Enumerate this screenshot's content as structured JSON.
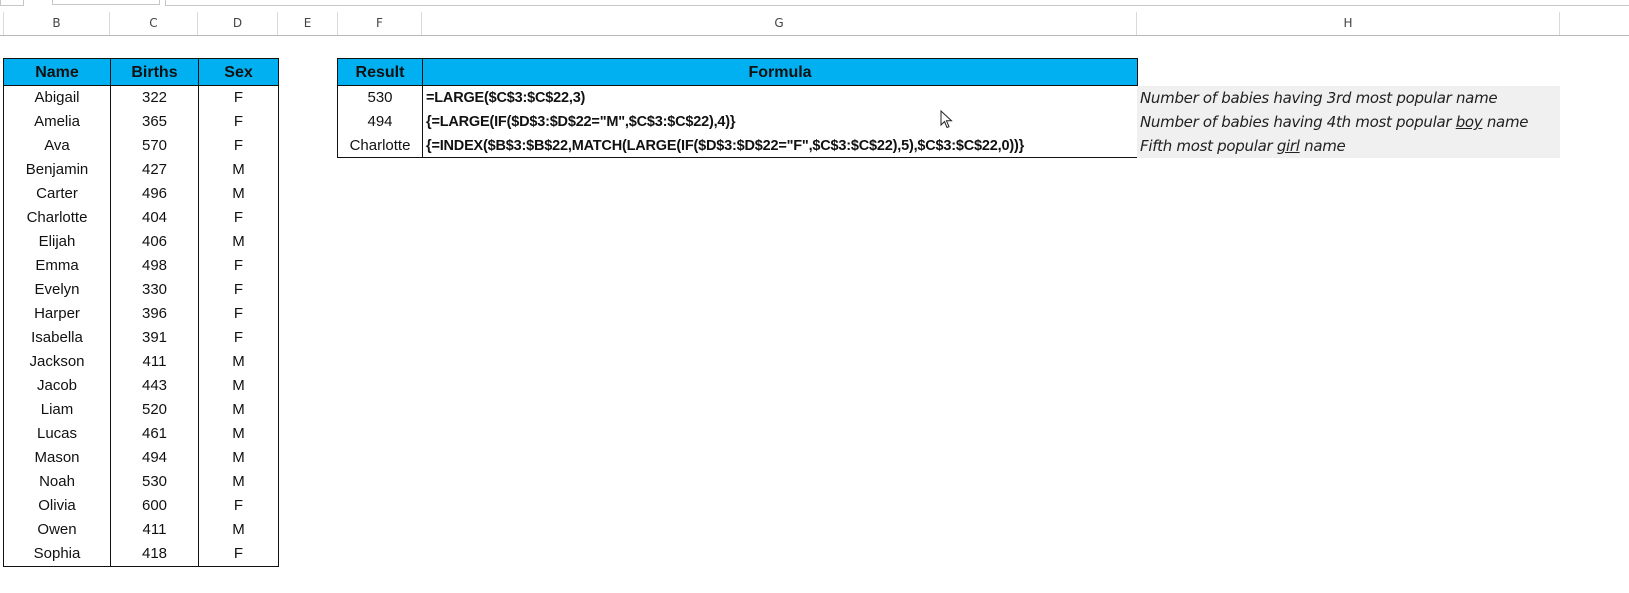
{
  "columns": [
    "B",
    "C",
    "D",
    "E",
    "F",
    "G",
    "H"
  ],
  "names_table": {
    "headers": [
      "Name",
      "Births",
      "Sex"
    ],
    "rows": [
      [
        "Abigail",
        "322",
        "F"
      ],
      [
        "Amelia",
        "365",
        "F"
      ],
      [
        "Ava",
        "570",
        "F"
      ],
      [
        "Benjamin",
        "427",
        "M"
      ],
      [
        "Carter",
        "496",
        "M"
      ],
      [
        "Charlotte",
        "404",
        "F"
      ],
      [
        "Elijah",
        "406",
        "M"
      ],
      [
        "Emma",
        "498",
        "F"
      ],
      [
        "Evelyn",
        "330",
        "F"
      ],
      [
        "Harper",
        "396",
        "F"
      ],
      [
        "Isabella",
        "391",
        "F"
      ],
      [
        "Jackson",
        "411",
        "M"
      ],
      [
        "Jacob",
        "443",
        "M"
      ],
      [
        "Liam",
        "520",
        "M"
      ],
      [
        "Lucas",
        "461",
        "M"
      ],
      [
        "Mason",
        "494",
        "M"
      ],
      [
        "Noah",
        "530",
        "M"
      ],
      [
        "Olivia",
        "600",
        "F"
      ],
      [
        "Owen",
        "411",
        "M"
      ],
      [
        "Sophia",
        "418",
        "F"
      ]
    ]
  },
  "results_table": {
    "headers": [
      "Result",
      "Formula"
    ],
    "rows": [
      {
        "result": "530",
        "formula": "=LARGE($C$3:$C$22,3)",
        "note_pre": "Number of babies having 3rd most popular name",
        "note_u": "",
        "note_post": ""
      },
      {
        "result": "494",
        "formula": "{=LARGE(IF($D$3:$D$22=\"M\",$C$3:$C$22),4)}",
        "note_pre": "Number of babies having 4th most popular ",
        "note_u": "boy",
        "note_post": " name"
      },
      {
        "result": "Charlotte",
        "formula": "{=INDEX($B$3:$B$22,MATCH(LARGE(IF($D$3:$D$22=\"F\",$C$3:$C$22),5),$C$3:$C$22,0))}",
        "note_pre": "Fifth most popular ",
        "note_u": "girl",
        "note_post": " name"
      }
    ]
  },
  "colors": {
    "header_fill": "#00b0f0",
    "note_fill": "#f0f0f0",
    "border": "#111111"
  },
  "icons": {
    "cursor": "mouse-pointer-icon"
  }
}
